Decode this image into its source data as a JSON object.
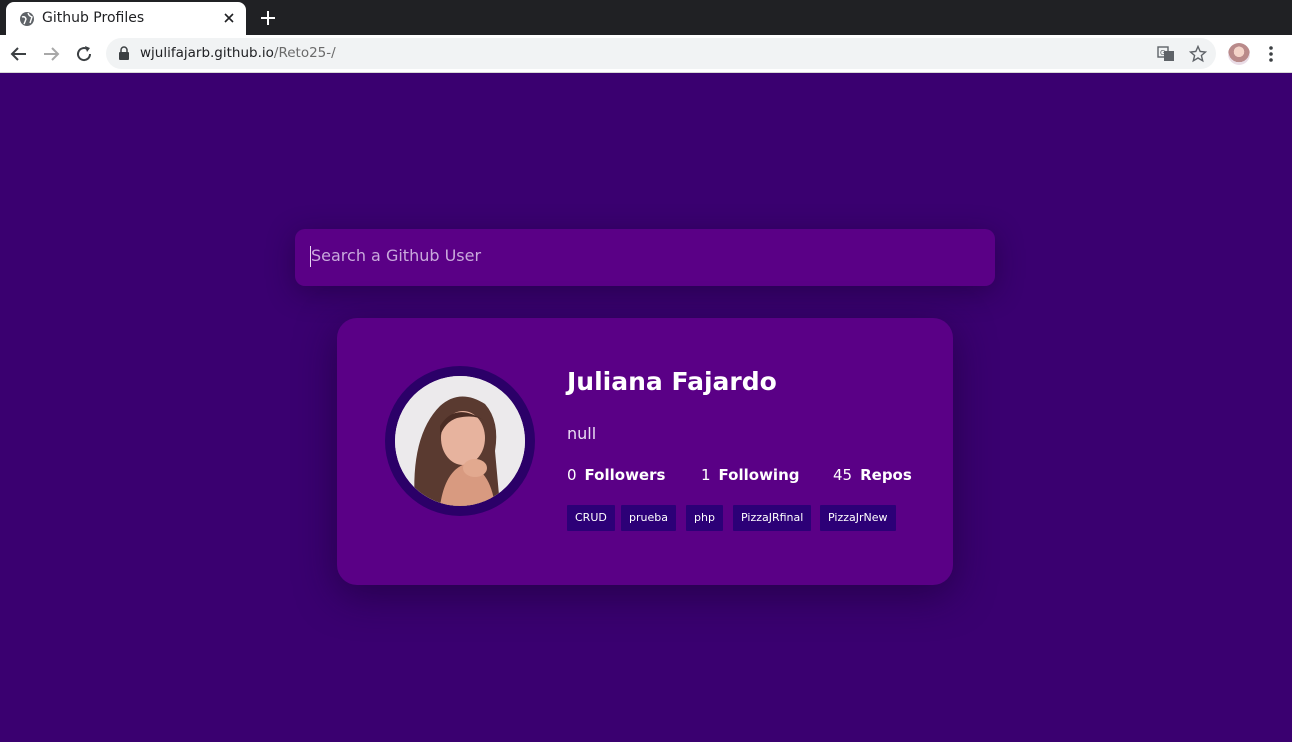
{
  "browser": {
    "tab_title": "Github Profiles",
    "url_host": "wjulifajarb.github.io",
    "url_path": "/Reto25-/"
  },
  "search": {
    "placeholder": "Search a Github User"
  },
  "profile": {
    "name": "Juliana Fajardo",
    "bio": "null",
    "followers_count": "0",
    "followers_label": "Followers",
    "following_count": "1",
    "following_label": "Following",
    "repos_count": "45",
    "repos_label": "Repos",
    "repos": [
      "CRUD",
      "prueba",
      "php",
      "PizzaJRfinal",
      "PizzaJrNew"
    ]
  },
  "colors": {
    "background": "#3a0070",
    "card": "#5a0086",
    "repo_tag": "#2c0077"
  }
}
